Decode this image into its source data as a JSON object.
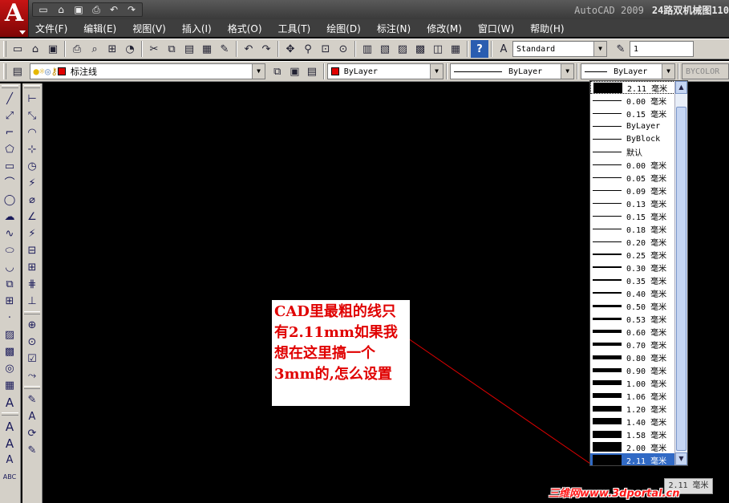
{
  "title_bar": {
    "app_name": "AutoCAD 2009",
    "document": "24路双机械图110"
  },
  "quick_access": [
    "new-icon",
    "open-icon",
    "save-icon",
    "print-icon",
    "undo-icon",
    "redo-icon"
  ],
  "menu": [
    "文件(F)",
    "编辑(E)",
    "视图(V)",
    "插入(I)",
    "格式(O)",
    "工具(T)",
    "绘图(D)",
    "标注(N)",
    "修改(M)",
    "窗口(W)",
    "帮助(H)"
  ],
  "standard_toolbar": {
    "text_style": "Standard",
    "scale": "1"
  },
  "layers_toolbar": {
    "current_layer": "标注线",
    "layer_color": "#e00000"
  },
  "properties_toolbar": {
    "color": "ByLayer",
    "linetype": "ByLayer",
    "lineweight": "ByLayer",
    "plot_style": "BYCOLOR"
  },
  "lineweight_dropdown": {
    "items": [
      {
        "label": "2.11 毫米",
        "weight": 2.11
      },
      {
        "label": "0.00 毫米",
        "weight": 0.0
      },
      {
        "label": "0.15 毫米",
        "weight": 0.15
      },
      {
        "label": "ByLayer",
        "weight": 0.0
      },
      {
        "label": "ByBlock",
        "weight": 0.0
      },
      {
        "label": "默认",
        "weight": 0.0
      },
      {
        "label": "0.00 毫米",
        "weight": 0.0
      },
      {
        "label": "0.05 毫米",
        "weight": 0.05
      },
      {
        "label": "0.09 毫米",
        "weight": 0.09
      },
      {
        "label": "0.13 毫米",
        "weight": 0.13
      },
      {
        "label": "0.15 毫米",
        "weight": 0.15
      },
      {
        "label": "0.18 毫米",
        "weight": 0.18
      },
      {
        "label": "0.20 毫米",
        "weight": 0.2
      },
      {
        "label": "0.25 毫米",
        "weight": 0.25
      },
      {
        "label": "0.30 毫米",
        "weight": 0.3
      },
      {
        "label": "0.35 毫米",
        "weight": 0.35
      },
      {
        "label": "0.40 毫米",
        "weight": 0.4
      },
      {
        "label": "0.50 毫米",
        "weight": 0.5
      },
      {
        "label": "0.53 毫米",
        "weight": 0.53
      },
      {
        "label": "0.60 毫米",
        "weight": 0.6
      },
      {
        "label": "0.70 毫米",
        "weight": 0.7
      },
      {
        "label": "0.80 毫米",
        "weight": 0.8
      },
      {
        "label": "0.90 毫米",
        "weight": 0.9
      },
      {
        "label": "1.00 毫米",
        "weight": 1.0
      },
      {
        "label": "1.06 毫米",
        "weight": 1.06
      },
      {
        "label": "1.20 毫米",
        "weight": 1.2
      },
      {
        "label": "1.40 毫米",
        "weight": 1.4
      },
      {
        "label": "1.58 毫米",
        "weight": 1.58
      },
      {
        "label": "2.00 毫米",
        "weight": 2.0
      },
      {
        "label": "2.11 毫米",
        "weight": 2.11
      }
    ],
    "selected_index": 29
  },
  "annotation": "CAD里最粗的线只有2.11mm如果我想在这里搞一个3mm的,怎么设置",
  "tooltip": "2.11 毫米",
  "watermark": "三维网www.3dportal.cn"
}
